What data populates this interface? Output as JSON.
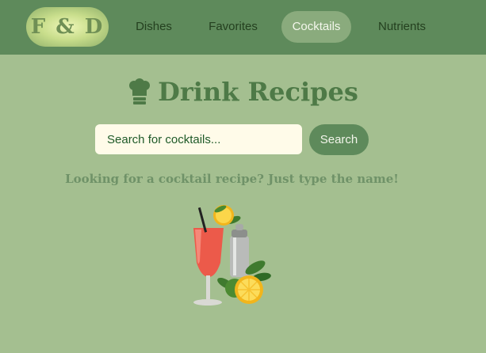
{
  "nav": {
    "logo_text": "F & D",
    "items": [
      {
        "label": "Dishes",
        "active": false
      },
      {
        "label": "Favorites",
        "active": false
      },
      {
        "label": "Cocktails",
        "active": true
      },
      {
        "label": "Nutrients",
        "active": false
      }
    ]
  },
  "page": {
    "title": "Drink Recipes",
    "title_icon": "chef-hat-icon"
  },
  "search": {
    "placeholder": "Search for cocktails...",
    "value": "",
    "button_label": "Search"
  },
  "hint_text": "Looking for a cocktail recipe? Just type the name!",
  "illustration": "cocktail-illustration",
  "colors": {
    "background": "#a4bf90",
    "navbar": "#5e8a5b",
    "active_tab": "#8aab7d",
    "title": "#4e7a47",
    "input_bg": "#fffbe9"
  }
}
